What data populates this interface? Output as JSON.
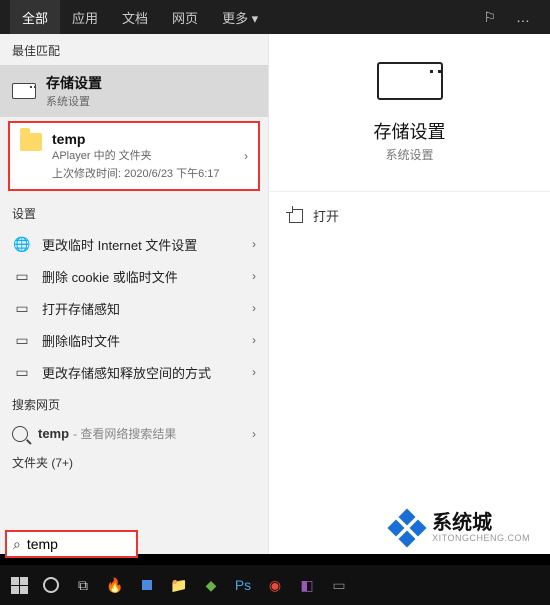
{
  "topbar": {
    "tabs": [
      "全部",
      "应用",
      "文档",
      "网页",
      "更多 ▾"
    ],
    "feedback_icon": "feedback",
    "more_icon": "…"
  },
  "left": {
    "best_match_label": "最佳匹配",
    "best_match": {
      "title": "存储设置",
      "subtitle": "系统设置"
    },
    "folder": {
      "name": "temp",
      "location": "APlayer 中的 文件夹",
      "modified": "上次修改时间: 2020/6/23 下午6:17"
    },
    "settings_label": "设置",
    "settings_items": [
      "更改临时 Internet 文件设置",
      "删除 cookie 或临时文件",
      "打开存储感知",
      "删除临时文件",
      "更改存储感知释放空间的方式"
    ],
    "search_web_label": "搜索网页",
    "search_web": {
      "query": "temp",
      "hint": " - 查看网络搜索结果"
    },
    "folders_label": "文件夹 (7+)"
  },
  "right": {
    "title": "存储设置",
    "subtitle": "系统设置",
    "open_label": "打开"
  },
  "search": {
    "value": "temp"
  },
  "logo": {
    "cn": "系统城",
    "en": "XITONGCHENG.COM"
  }
}
